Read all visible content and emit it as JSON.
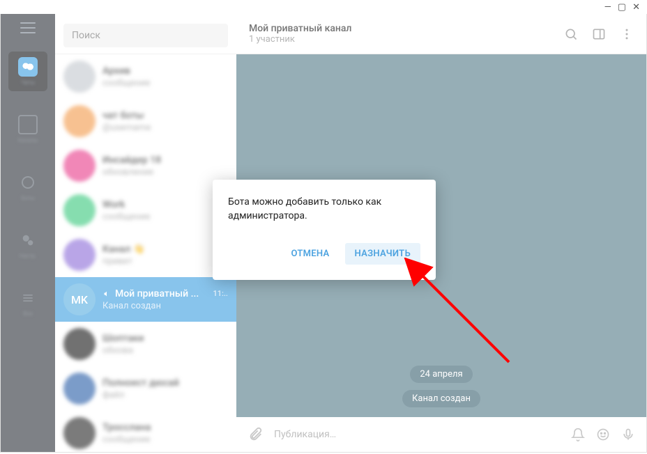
{
  "window": {
    "minimize": "—",
    "maximize": "▢",
    "close": "✕"
  },
  "sidebar": {
    "items": [
      {
        "label": "Чаты"
      },
      {
        "label": "Каналы"
      },
      {
        "label": "Боты"
      },
      {
        "label": "Настр."
      },
      {
        "label": "Все"
      }
    ]
  },
  "search": {
    "placeholder": "Поиск"
  },
  "chats": {
    "items": [
      {
        "name": "Архив",
        "sub": "сообщение",
        "color": "#c4c9cf"
      },
      {
        "name": "чат боты",
        "sub": "@username",
        "color": "#f39c4e"
      },
      {
        "name": "Инсайдер 18",
        "sub": "обновление",
        "color": "#e83e8c"
      },
      {
        "name": "Work",
        "sub": "сообщение",
        "color": "#3cc97f"
      },
      {
        "name": "Канал 👋",
        "sub": "привет",
        "color": "#8e6fd9"
      }
    ],
    "selected": {
      "avatar": "MK",
      "name": "Мой приватный ...",
      "time": "11:..",
      "sub": "Канал создан",
      "color": "#5aaee0"
    },
    "more": [
      {
        "name": "Шоптаки",
        "sub": "обнова",
        "color": "#1a1a1a"
      },
      {
        "name": "Полноест дюсай",
        "sub": "файл",
        "color": "#2b5fa8"
      },
      {
        "name": "Тросслана",
        "sub": "сообщение",
        "color": "#2a2a2a"
      }
    ]
  },
  "main": {
    "title": "Мой приватный канал",
    "subtitle": "1 участник",
    "date_pill": "24 апреля",
    "created_pill": "Канал создан",
    "input_placeholder": "Публикация…"
  },
  "dialog": {
    "text": "Бота можно добавить только как администратора.",
    "cancel": "ОТМЕНА",
    "confirm": "НАЗНАЧИТЬ"
  },
  "icons": {
    "megaphone": "📢"
  }
}
